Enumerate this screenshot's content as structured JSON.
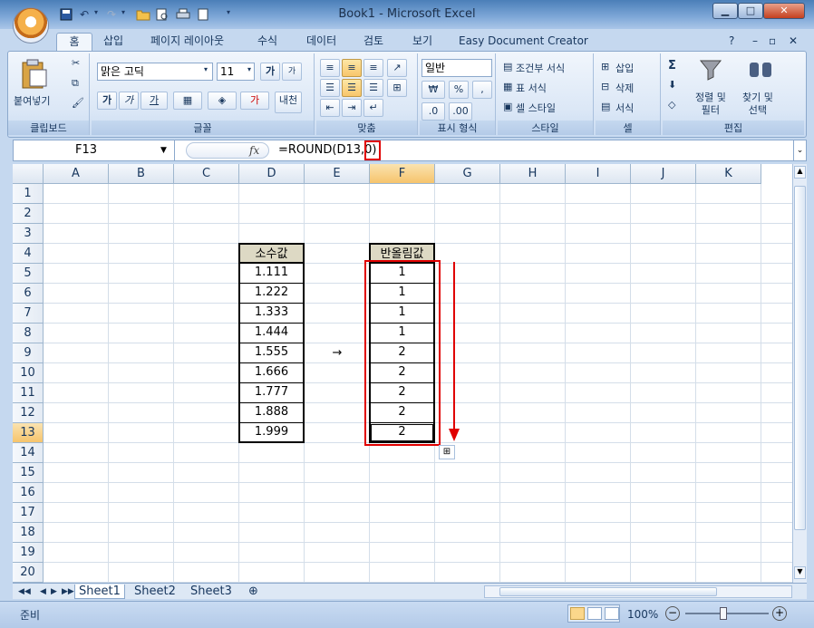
{
  "window": {
    "title": "Book1 - Microsoft Excel",
    "minimize": "▁",
    "maximize": "□",
    "close": "✕"
  },
  "quick_access": {
    "save_icon": "save-icon",
    "undo_icon": "undo-icon",
    "redo_icon": "redo-icon",
    "open_icon": "open-icon",
    "preview_icon": "print-preview-icon",
    "print_icon": "print-icon",
    "new_icon": "new-icon",
    "customize_icon": "chevron-down-icon"
  },
  "tabs": [
    "홈",
    "삽입",
    "페이지 레이아웃",
    "수식",
    "데이터",
    "검토",
    "보기",
    "Easy Document Creator"
  ],
  "ribbon": {
    "clipboard": {
      "paste": "붙여넣기",
      "label": "클립보드"
    },
    "font": {
      "name": "맑은 고딕",
      "size": "11",
      "grow": "가",
      "shrink": "가",
      "bold": "가",
      "italic": "가",
      "underline": "가",
      "label": "글꼴",
      "color_bar": "#cc0000"
    },
    "alignment": {
      "label": "맞춤"
    },
    "number": {
      "format": "일반",
      "currency": "₩",
      "percent": "%",
      "comma": ",",
      "label": "표시 형식"
    },
    "styles": {
      "cond": "조건부 서식",
      "table": "표 서식",
      "cell": "셀 스타일",
      "label": "스타일"
    },
    "cells": {
      "insert": "삽입",
      "delete": "삭제",
      "format": "서식",
      "label": "셀"
    },
    "editing": {
      "sort": "정렬 및\n필터",
      "find": "찾기 및\n선택",
      "label": "편집"
    }
  },
  "formula_bar": {
    "name_box": "F13",
    "fx": "fx",
    "formula": "=ROUND(D13,0)"
  },
  "columns": [
    "A",
    "B",
    "C",
    "D",
    "E",
    "F",
    "G",
    "H",
    "I",
    "J",
    "K"
  ],
  "selected_column": "F",
  "rows": [
    "1",
    "2",
    "3",
    "4",
    "5",
    "6",
    "7",
    "8",
    "9",
    "10",
    "11",
    "12",
    "13",
    "14",
    "15",
    "16",
    "17",
    "18",
    "19",
    "20"
  ],
  "selected_row": "13",
  "table": {
    "header_d": "소수값",
    "header_f": "반올림값",
    "d_values": [
      "1.111",
      "1.222",
      "1.333",
      "1.444",
      "1.555",
      "1.666",
      "1.777",
      "1.888",
      "1.999"
    ],
    "f_values": [
      "1",
      "1",
      "1",
      "1",
      "2",
      "2",
      "2",
      "2",
      "2"
    ],
    "arrow": "→"
  },
  "sheets": [
    "Sheet1",
    "Sheet2",
    "Sheet3"
  ],
  "status": {
    "mode": "준비",
    "zoom": "100%"
  },
  "colors": {
    "highlight": "#e00000",
    "header_fill": "#ddd9c4"
  }
}
